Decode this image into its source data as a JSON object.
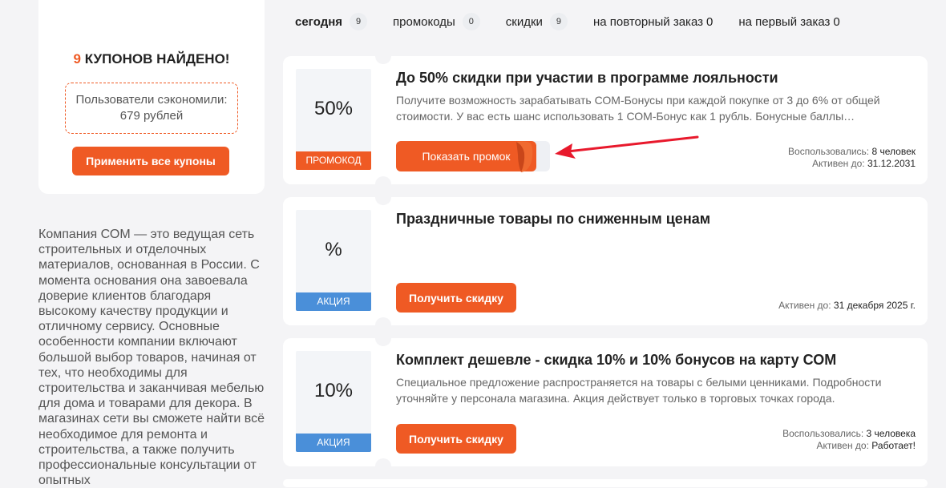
{
  "summary": {
    "found_count": "9",
    "found_label": "КУПОНОВ НАЙДЕНО!",
    "saved_text": "Пользователи сэкономили: 679 рублей",
    "apply_all_label": "Применить все купоны"
  },
  "company_text": "Компания СОМ — это ведущая сеть строительных и отделочных материалов, основанная в России. С момента основания она завоевала доверие клиентов благодаря высокому качеству продукции и отличному сервису. Основные особенности компании включают большой выбор товаров, начиная от тех, что необходимы для строительства и заканчивая мебелью для дома и товарами для декора. В магазинах сети вы сможете найти всё необходимое для ремонта и строительства, а также получить профессиональные консультации от опытных",
  "tabs": [
    {
      "label": "сегодня",
      "count": "9"
    },
    {
      "label": "промокоды",
      "count": "0"
    },
    {
      "label": "скидки",
      "count": "9"
    },
    {
      "label": "на повторный заказ",
      "count": "0"
    },
    {
      "label": "на первый заказ",
      "count": "0"
    }
  ],
  "coupons": [
    {
      "badge_value": "50%",
      "badge_label": "ПРОМОКОД",
      "title": "До 50% скидки при участии в программе лояльности",
      "description": "Получите возможность зарабатывать СОМ-Бонусы при каждой покупке от 3 до 6% от общей стоимости. У вас есть шанс использовать 1 СОМ-Бонус как 1 рубль. Бонусные баллы…",
      "button_label": "Показать промок",
      "used_label": "Воспользовались:",
      "used_value": "8 человек",
      "active_label": "Активен до:",
      "active_value": "31.12.2031"
    },
    {
      "badge_value": "%",
      "badge_label": "АКЦИЯ",
      "title": "Праздничные товары по сниженным ценам",
      "description": "",
      "button_label": "Получить скидку",
      "active_label": "Активен до:",
      "active_value": "31 декабря 2025 г."
    },
    {
      "badge_value": "10%",
      "badge_label": "АКЦИЯ",
      "title": "Комплект дешевле - скидка 10% и 10% бонусов на карту СОМ",
      "description": "Специальное предложение распространяется на товары с белыми ценниками. Подробности уточняйте у персонала магазина. Акция действует только в торговых точках города.",
      "button_label": "Получить скидку",
      "used_label": "Воспользовались:",
      "used_value": "3 человека",
      "active_label": "Активен до:",
      "active_value": "Работает!"
    }
  ],
  "colors": {
    "accent": "#ef5a24",
    "action_badge": "#4a8fd9",
    "arrow": "#e8192c"
  }
}
